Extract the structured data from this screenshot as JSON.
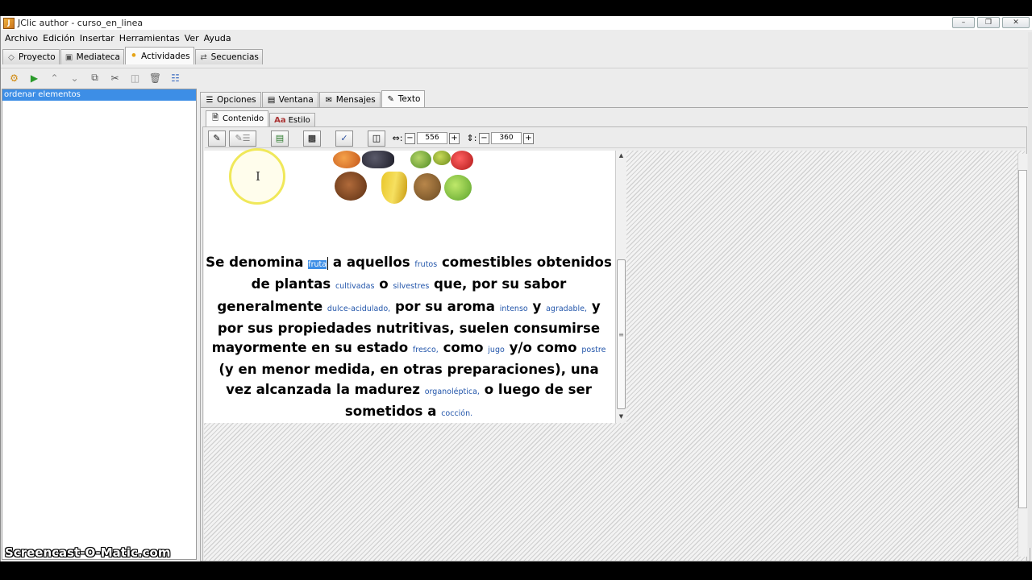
{
  "window": {
    "title": "JClic author - curso_en_linea",
    "controls": [
      "minimize",
      "maximize",
      "close"
    ]
  },
  "menu": [
    "Archivo",
    "Edición",
    "Insertar",
    "Herramientas",
    "Ver",
    "Ayuda"
  ],
  "main_tabs": [
    {
      "label": "Proyecto",
      "icon": "project-icon",
      "active": false
    },
    {
      "label": "Mediateca",
      "icon": "media-icon",
      "active": false
    },
    {
      "label": "Actividades",
      "icon": "activities-icon",
      "active": true
    },
    {
      "label": "Secuencias",
      "icon": "sequences-icon",
      "active": false
    }
  ],
  "toolbar_icons": [
    "new-activity-icon",
    "play-icon",
    "move-up-icon",
    "move-down-icon",
    "copy-icon",
    "cut-icon",
    "paste-icon",
    "delete-icon",
    "tree-icon"
  ],
  "activity_list": {
    "selected": "ordenar elementos"
  },
  "sub_tabs": [
    {
      "label": "Opciones",
      "active": false
    },
    {
      "label": "Ventana",
      "active": false
    },
    {
      "label": "Mensajes",
      "active": false
    },
    {
      "label": "Texto",
      "active": true
    }
  ],
  "inner_tabs": [
    {
      "label": "Contenido",
      "active": true
    },
    {
      "label": "Estilo",
      "active": false
    }
  ],
  "editor": {
    "width": "556",
    "height": "360"
  },
  "document": {
    "segments": [
      {
        "t": "Se denomina "
      },
      {
        "tgt": "fruta",
        "sel": true
      },
      {
        "t": " a aquellos "
      },
      {
        "tgt": "frutos"
      },
      {
        "t": " comestibles obtenidos de plantas "
      },
      {
        "tgt": "cultivadas"
      },
      {
        "t": " o "
      },
      {
        "tgt": "silvestres"
      },
      {
        "t": " que, por su sabor generalmente "
      },
      {
        "tgt": "dulce-acidulado,"
      },
      {
        "t": " por su aroma "
      },
      {
        "tgt": "intenso"
      },
      {
        "t": " y "
      },
      {
        "tgt": "agradable,"
      },
      {
        "t": " y por sus propiedades nutritivas, suelen consumirse mayormente en su estado "
      },
      {
        "tgt": "fresco,"
      },
      {
        "t": " como "
      },
      {
        "tgt": "jugo"
      },
      {
        "t": " y/o como "
      },
      {
        "tgt": "postre"
      },
      {
        "t": " (y en menor medida, en otras preparaciones), una vez alcanzada la madurez "
      },
      {
        "tgt": "organoléptica,"
      },
      {
        "t": " o luego de ser sometidos a "
      },
      {
        "tgt": "cocción."
      }
    ]
  },
  "watermark": "Screencast-O-Matic.com",
  "colors": {
    "selection": "#3d8ee6",
    "target_text": "#2255aa",
    "cursor_highlight": "#f0e85a"
  }
}
